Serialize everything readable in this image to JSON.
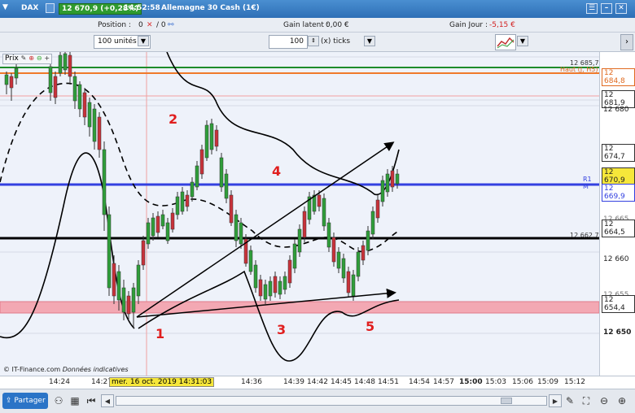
{
  "titlebar": {
    "symbol": "DAX",
    "price_badge": "12 670,9 (+0,28%)",
    "time": "14:52:58",
    "instrument": "Allemagne 30 Cash (1€)"
  },
  "toolbar1": {
    "position_label": "Position :",
    "position_value": "0",
    "position_value2": "/ 0",
    "latent_label": "Gain latent :",
    "latent_value": "0,00 €",
    "day_label": "Gain Jour :",
    "day_value": "-5,15 €"
  },
  "toolbar2": {
    "units_select": "100 unités",
    "ticks_value": "100",
    "ticks_label": "(x) ticks"
  },
  "chart": {
    "prix_label": "Prix",
    "source_text": "© IT-Finance.com",
    "source_note": "Données indicatives",
    "annotations": [
      "1",
      "2",
      "3",
      "4",
      "5"
    ],
    "line_labels": {
      "green": "12 685,7",
      "orange": "Haut (J, H5)",
      "blue": "R1 M",
      "black": "12 662,7"
    },
    "yaxis_ticks": [
      "12 680",
      "12 660",
      "12 650"
    ],
    "yaxis_boxes": [
      "12 684,8",
      "12 681,9",
      "12 674,7",
      "12 670,9",
      "12 669,9",
      "12 664,5",
      "12 654,4"
    ],
    "yaxis_partial": [
      "12 665",
      "12 655"
    ],
    "cursor_label": "mer. 16 oct. 2019 14:31:03"
  },
  "xaxis": {
    "ticks": [
      "14:24",
      "14:27",
      "14:36",
      "14:39",
      "14:42",
      "14:45",
      "14:48",
      "14:51",
      "14:54",
      "14:57",
      "15:00",
      "15:03",
      "15:06",
      "15:09",
      "15:12"
    ]
  },
  "statusbar": {
    "share_label": "Partager"
  },
  "colors": {
    "green_line": "#1e8c2a",
    "orange_line": "#f07a2a",
    "blue_line": "#3340e0",
    "black_line": "#000000",
    "support_zone": "#f3a8b3",
    "annotation": "#e01e1e",
    "candle_up": "#2f9e3a",
    "candle_down": "#c8323a"
  }
}
